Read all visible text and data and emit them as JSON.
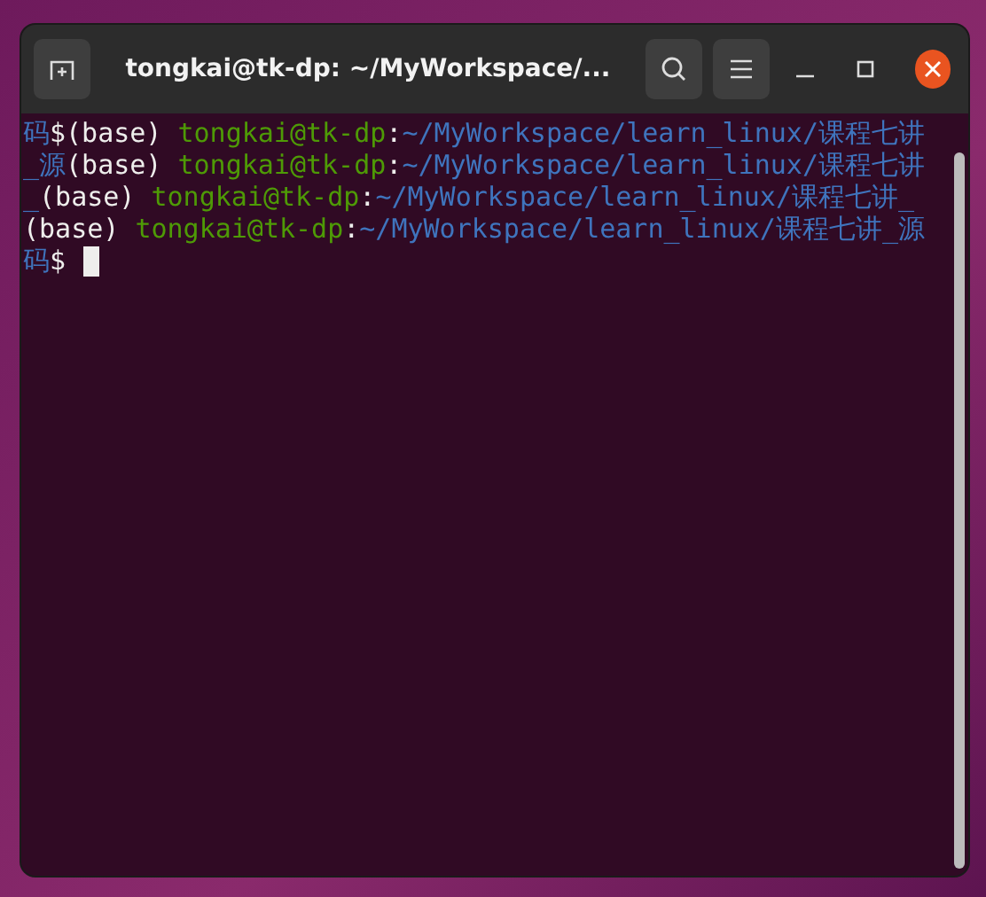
{
  "window": {
    "title": "tongkai@tk-dp: ~/MyWorkspace/..."
  },
  "terminal": {
    "lines": [
      {
        "segments": [
          {
            "kind": "path",
            "text": "码"
          },
          {
            "kind": "plain",
            "text": "$(base) "
          },
          {
            "kind": "user",
            "text": "tongkai@tk-dp"
          },
          {
            "kind": "plain",
            "text": ":"
          },
          {
            "kind": "path",
            "text": "~/MyWorkspace/learn_linux/课程七讲"
          }
        ]
      },
      {
        "segments": [
          {
            "kind": "path",
            "text": "_源"
          },
          {
            "kind": "plain",
            "text": "(base) "
          },
          {
            "kind": "user",
            "text": "tongkai@tk-dp"
          },
          {
            "kind": "plain",
            "text": ":"
          },
          {
            "kind": "path",
            "text": "~/MyWorkspace/learn_linux/课程七讲"
          }
        ]
      },
      {
        "segments": [
          {
            "kind": "path",
            "text": "_"
          },
          {
            "kind": "plain",
            "text": "(base) "
          },
          {
            "kind": "user",
            "text": "tongkai@tk-dp"
          },
          {
            "kind": "plain",
            "text": ":"
          },
          {
            "kind": "path",
            "text": "~/MyWorkspace/learn_linux/课程七讲_"
          }
        ]
      },
      {
        "segments": [
          {
            "kind": "plain",
            "text": "(base) "
          },
          {
            "kind": "user",
            "text": "tongkai@tk-dp"
          },
          {
            "kind": "plain",
            "text": ":"
          },
          {
            "kind": "path",
            "text": "~/MyWorkspace/learn_linux/课程七讲_源"
          }
        ]
      },
      {
        "segments": [
          {
            "kind": "path",
            "text": "码"
          },
          {
            "kind": "plain",
            "text": "$ "
          },
          {
            "kind": "cursor"
          }
        ]
      }
    ]
  }
}
